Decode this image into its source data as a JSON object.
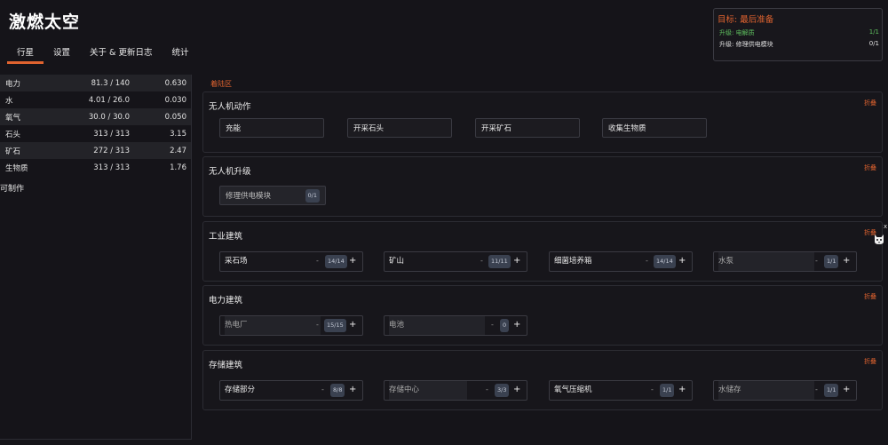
{
  "app": {
    "title": "激燃太空"
  },
  "tabs": [
    {
      "label": "行星",
      "active": true
    },
    {
      "label": "设置"
    },
    {
      "label": "关于 & 更新日志"
    },
    {
      "label": "统计"
    }
  ],
  "resources": [
    {
      "name": "电力",
      "amount": "81.3 / 140",
      "rate": "0.630"
    },
    {
      "name": "水",
      "amount": "4.01 / 26.0",
      "rate": "0.030"
    },
    {
      "name": "氧气",
      "amount": "30.0 / 30.0",
      "rate": "0.050"
    },
    {
      "name": "石头",
      "amount": "313 / 313",
      "rate": "3.15"
    },
    {
      "name": "矿石",
      "amount": "272 / 313",
      "rate": "2.47"
    },
    {
      "name": "生物质",
      "amount": "313 / 313",
      "rate": "1.76"
    }
  ],
  "craftable_label": "可制作",
  "goal": {
    "title": "目标:  最后准备",
    "items": [
      {
        "label": "升级: 电解质",
        "progress": "1/1",
        "done": true
      },
      {
        "label": "升级: 修理供电模块",
        "progress": "0/1",
        "done": false
      }
    ]
  },
  "landing_label": "着陆区",
  "collapse_label": "折叠",
  "drone_actions": {
    "title": "无人机动作",
    "buttons": [
      "充能",
      "开采石头",
      "开采矿石",
      "收集生物质"
    ]
  },
  "drone_upgrades": {
    "title": "无人机升级",
    "items": [
      {
        "label": "修理供电模块",
        "count": "0/1"
      }
    ]
  },
  "industrial": {
    "title": "工业建筑",
    "buildings": [
      {
        "name": "采石场",
        "count": "14/14"
      },
      {
        "name": "矿山",
        "count": "11/11"
      },
      {
        "name": "细菌培养箱",
        "count": "14/14"
      },
      {
        "name": "水泵",
        "count": "1/1"
      }
    ]
  },
  "power": {
    "title": "电力建筑",
    "buildings": [
      {
        "name": "热电厂",
        "count": "15/15"
      },
      {
        "name": "电池",
        "count": "0"
      }
    ]
  },
  "storage": {
    "title": "存储建筑",
    "buildings": [
      {
        "name": "存储部分",
        "count": "8/8"
      },
      {
        "name": "存储中心",
        "count": "3/3"
      },
      {
        "name": "氧气压缩机",
        "count": "1/1"
      },
      {
        "name": "水储存",
        "count": "1/1"
      }
    ]
  },
  "controls": {
    "minus": "-",
    "plus": "+"
  },
  "side_close": "x",
  "colors": {
    "accent": "#e0632f",
    "success": "#5fc05f",
    "background": "#151419"
  }
}
